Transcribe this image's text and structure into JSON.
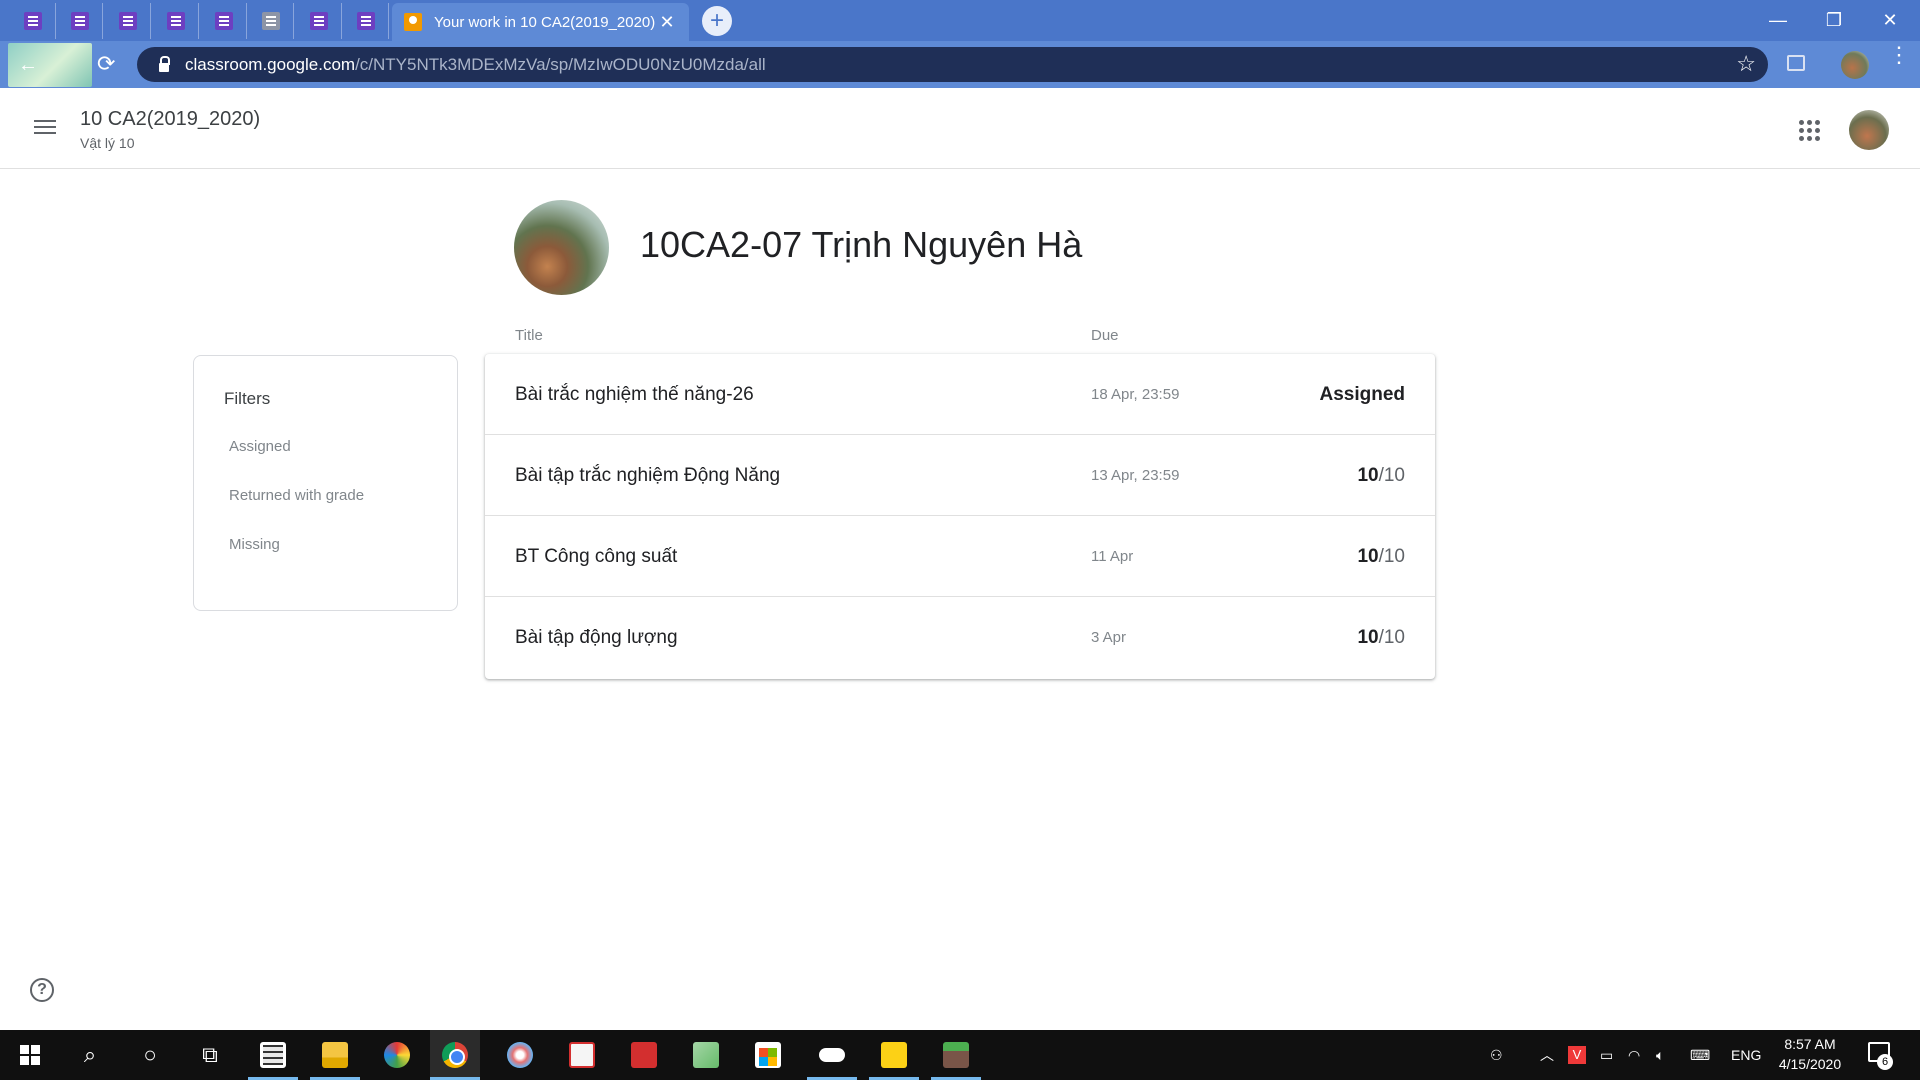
{
  "browser": {
    "pinned_tabs": [
      {
        "icon": "google-forms-icon"
      },
      {
        "icon": "google-forms-icon"
      },
      {
        "icon": "google-forms-icon"
      },
      {
        "icon": "google-forms-icon"
      },
      {
        "icon": "google-forms-icon"
      },
      {
        "icon": "google-forms-gray-icon"
      },
      {
        "icon": "google-forms-icon"
      },
      {
        "icon": "google-forms-icon"
      }
    ],
    "active_tab": {
      "title": "Your work in 10 CA2(2019_2020)",
      "close": "✕"
    },
    "new_tab": "+",
    "window_controls": {
      "minimize": "—",
      "restore": "❐",
      "close": "✕"
    },
    "url": {
      "host": "classroom.google.com",
      "path": "/c/NTY5NTk3MDExMzVa/sp/MzIwODU0NzU0Mzda/all"
    },
    "toolbar_icons": {
      "back": "←",
      "reload": "⟳",
      "bookmark": "☆",
      "menu": "⋮"
    }
  },
  "header": {
    "class_name": "10 CA2(2019_2020)",
    "subject": "Vật lý 10"
  },
  "student": {
    "name": "10CA2-07 Trịnh Nguyên Hà"
  },
  "filters": {
    "title": "Filters",
    "items": [
      "Assigned",
      "Returned with grade",
      "Missing"
    ]
  },
  "columns": {
    "title": "Title",
    "due": "Due"
  },
  "work": [
    {
      "title": "Bài trắc nghiệm thế năng-26",
      "due": "18 Apr, 23:59",
      "status": "Assigned"
    },
    {
      "title": "Bài tập trắc nghiệm Động Năng",
      "due": "13 Apr, 23:59",
      "score": "10",
      "total": "/10"
    },
    {
      "title": "BT Công công suất",
      "due": "11 Apr",
      "score": "10",
      "total": "/10"
    },
    {
      "title": "Bài tập động lượng",
      "due": "3 Apr",
      "score": "10",
      "total": "/10"
    }
  ],
  "help": "?",
  "taskbar": {
    "apps": [
      "start",
      "search",
      "cortana",
      "task-view",
      "calculator",
      "file-explorer",
      "paint",
      "chrome",
      "paint-3d",
      "snipping",
      "tp-app",
      "notepad-plus",
      "store",
      "onedrive",
      "sticky-notes",
      "minecraft"
    ],
    "tray": {
      "language": "ENG",
      "time": "8:57 AM",
      "date": "4/15/2020",
      "notifications": "6"
    }
  },
  "colors": {
    "tabstrip": "#4a76c9",
    "toolbar": "#5e8ad6",
    "forms_purple": "#6d3fc1",
    "classroom_orange": "#f29900"
  }
}
